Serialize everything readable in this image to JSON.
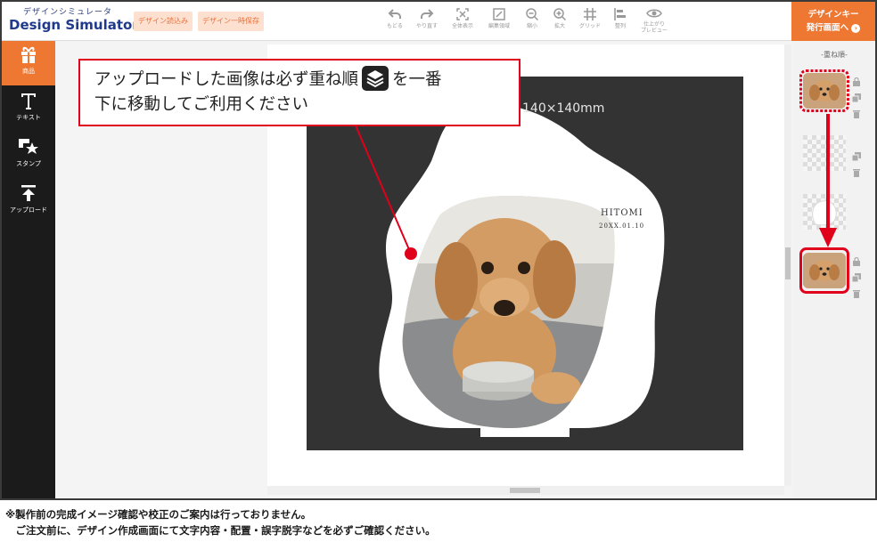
{
  "header": {
    "logo_sub": "デザインシミュレータ",
    "logo_main": "Design Simulator",
    "load_button": "デザイン読込み",
    "save_button": "デザイン一時保存",
    "cta_line1": "デザインキー",
    "cta_line2": "発行画面へ"
  },
  "toolbar": [
    {
      "label": "もどる",
      "icon": "undo-icon"
    },
    {
      "label": "やり直す",
      "icon": "redo-icon"
    },
    {
      "label": "全体表示",
      "icon": "fit-all-icon"
    },
    {
      "label": "編集領域",
      "icon": "edit-area-icon"
    },
    {
      "label": "縮小",
      "icon": "zoom-out-icon"
    },
    {
      "label": "拡大",
      "icon": "zoom-in-icon"
    },
    {
      "label": "グリッド",
      "icon": "grid-icon"
    },
    {
      "label": "整列",
      "icon": "align-icon"
    },
    {
      "label": "仕上がり\nプレビュー",
      "label_line1": "仕上がり",
      "label_line2": "プレビュー",
      "icon": "eye-icon"
    }
  ],
  "sidebar": {
    "items": [
      {
        "label": "商品",
        "icon": "gift-icon",
        "active": true
      },
      {
        "label": "テキスト",
        "icon": "text-icon",
        "active": false
      },
      {
        "label": "スタンプ",
        "icon": "stamp-icon",
        "active": false
      },
      {
        "label": "アップロード",
        "icon": "upload-icon",
        "active": false
      }
    ]
  },
  "canvas": {
    "size_label": "140×140mm",
    "design_name": "HITOMI",
    "design_date": "20XX.01.10"
  },
  "callout": {
    "line1_before": "アップロードした画像は必ず重ね順",
    "line1_after": "を一番",
    "line2": "下に移動してご利用ください",
    "icon": "layers-icon"
  },
  "layers": {
    "title": "-重ね順-"
  },
  "footnote": {
    "line1": "※製作前の完成イメージ確認や校正のご案内は行っておりません。",
    "line2": "　ご注文前に、デザイン作成画面にて文字内容・配置・誤字脱字などを必ずご確認ください。"
  },
  "colors": {
    "accent": "#ee7832",
    "highlight": "#e0001b",
    "board": "#333333",
    "sidebar": "#1b1b1b"
  }
}
